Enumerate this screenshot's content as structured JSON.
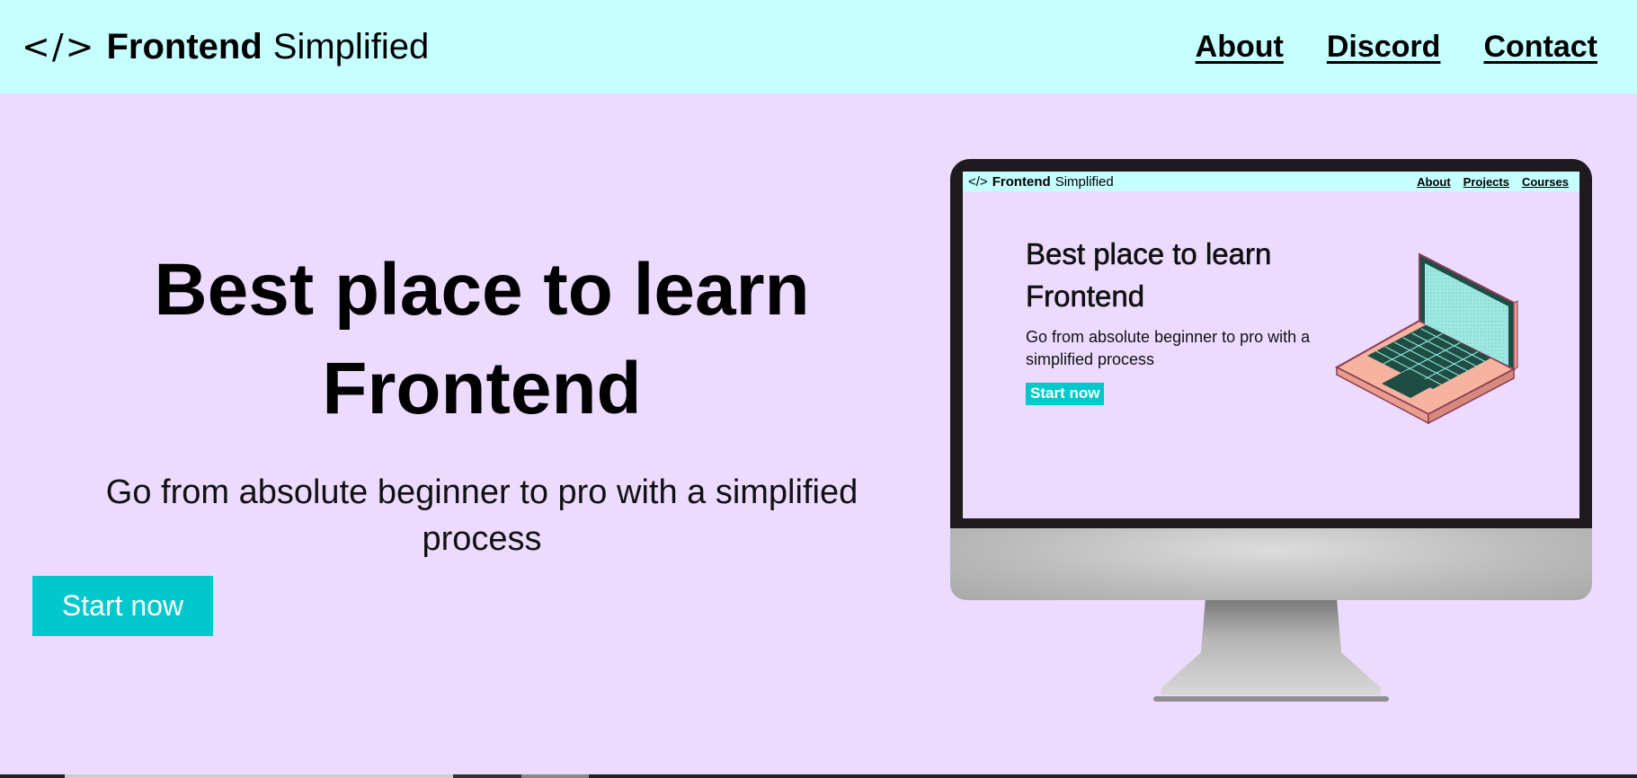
{
  "nav": {
    "logo_icon": "</>",
    "logo_bold": "Frontend",
    "logo_light": "Simplified",
    "links": [
      {
        "label": "About"
      },
      {
        "label": "Discord"
      },
      {
        "label": "Contact"
      }
    ]
  },
  "hero": {
    "title_line1": "Best place to learn",
    "title_line2": "Frontend",
    "subtitle": "Go from absolute beginner to pro with a simplified process",
    "cta_label": "Start now"
  },
  "illustration": {
    "mini_nav": {
      "logo_icon": "</>",
      "logo_bold": "Frontend",
      "logo_light": "Simplified",
      "links": [
        "About",
        "Projects",
        "Courses"
      ]
    },
    "mini_hero": {
      "title_line1": "Best place to learn",
      "title_line2": "Frontend",
      "subtitle": "Go from absolute beginner to pro with a simplified process",
      "cta_label": "Start now"
    }
  },
  "colors": {
    "nav_bg": "#c5ffff",
    "page_bg": "#ecdbff",
    "accent": "#00c8cc"
  }
}
